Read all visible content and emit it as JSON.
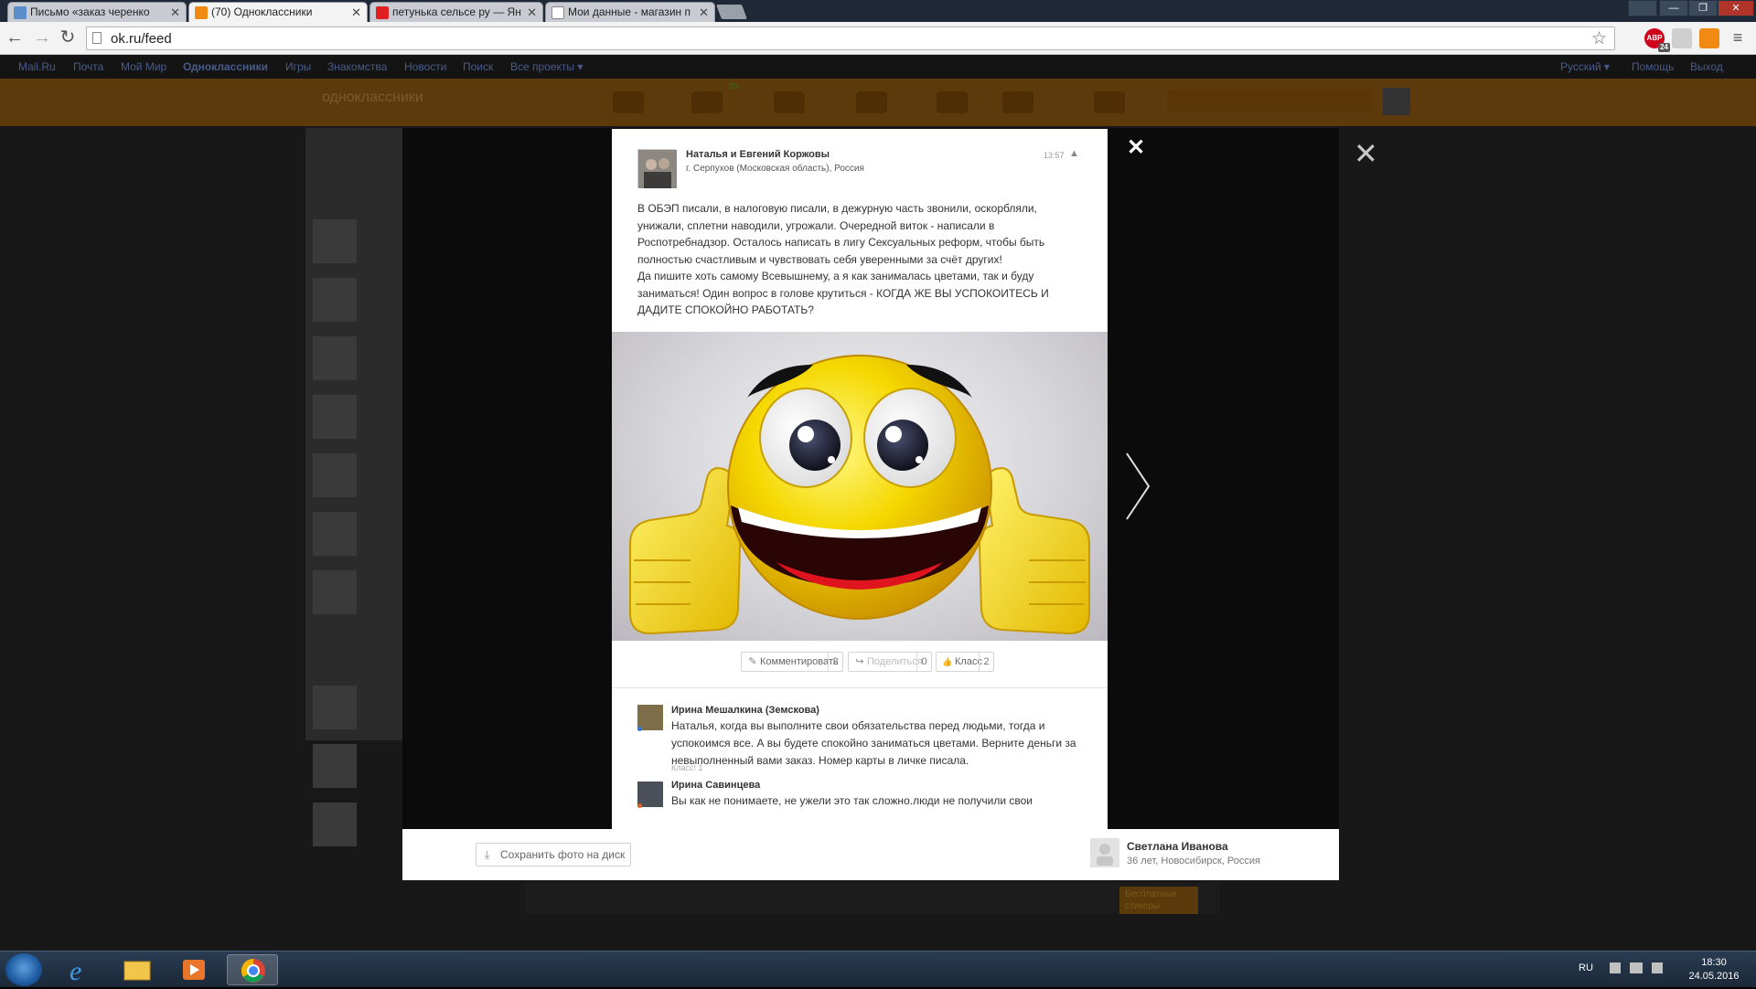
{
  "browser": {
    "tabs": [
      {
        "title": "Письмо «заказ черенко",
        "icon_color": "#5b8ec9",
        "active": false
      },
      {
        "title": "(70) Одноклассники",
        "icon_color": "#f08a12",
        "active": true
      },
      {
        "title": "петунька сельсе ру — Ян",
        "icon_color": "#e02020",
        "active": false
      },
      {
        "title": "Мои данные - магазин п",
        "icon_color": "#ffffff",
        "active": false
      }
    ],
    "tab_close": "✕",
    "url": "ok.ru/feed",
    "window_buttons": {
      "minimize": "—",
      "maximize": "❐",
      "close": "✕"
    },
    "nav": {
      "back": "←",
      "forward": "→",
      "reload": "↻"
    },
    "ext_abp": "ABP",
    "ext_abp_badge": "24",
    "star": "☆",
    "menu": "≡"
  },
  "page_bg": {
    "topline_links": [
      "Mail.Ru",
      "Почта",
      "Мой Мир",
      "Одноклассники",
      "Игры",
      "Знакомства",
      "Новости",
      "Поиск",
      "Все проекты ▾"
    ],
    "topline_right": [
      "Русский ▾",
      "Помощь",
      "Выход"
    ],
    "logo": "одноклассники",
    "header_badge": "70"
  },
  "viewer": {
    "close": "✕",
    "inner_close": "✕"
  },
  "post": {
    "author": "Наталья и Евгений Коржовы",
    "location": "г. Серпухов (Московская область), Россия",
    "time": "13:57",
    "warn": "▲",
    "text": "В ОБЭП писали, в налоговую писали, в дежурную часть звонили, оскорбляли,\nунижали, сплетни наводили, угрожали. Очередной виток - написали в\nРоспотребнадзор. Осталось написать в лигу Сексуальных реформ, чтобы быть\nполностью счастливым и чувствовать себя уверенными за счёт других!\nДа пишите хоть самому Всевышнему, а я как занималась цветами, так и буду\nзаниматься! Один вопрос в голове крутиться - КОГДА ЖЕ ВЫ УСПОКОИТЕСЬ  И\nДАДИТЕ СПОКОЙНО РАБОТАТЬ?",
    "photo_alt": "smiley thumbs up"
  },
  "actions": {
    "comment": {
      "label": "Комментировать",
      "count": "2",
      "icon": "✎"
    },
    "share": {
      "label": "Поделиться",
      "count": "0",
      "icon": "↪"
    },
    "like": {
      "label": "Класс",
      "count": "2",
      "icon": "👍"
    }
  },
  "comments": [
    {
      "name": "Ирина Мешалкина (Земскова)",
      "text": "Наталья, когда вы выполните свои обязательства перед людьми, тогда и успокоимся все. А вы будете спокойно заниматься цветами.  Верните деньги за невыполненный  вами заказ. Номер карты в личке писала.",
      "klass": "Класс! 1",
      "status_color": "#2f7bd6"
    },
    {
      "name": "Ирина Савинцева",
      "text": "Вы как не понимаете, не ужели это так сложно.люди не получили свои",
      "status_color": "#e06020"
    }
  ],
  "bottom": {
    "save": "Сохранить фото на диск",
    "save_icon": "⤓",
    "viewer_name": "Светлана Иванова",
    "viewer_info": "36 лет, Новосибирск, Россия"
  },
  "under": {
    "stickers": "Бесплатные стикеры"
  },
  "taskbar": {
    "lang": "RU",
    "time": "18:30",
    "date": "24.05.2016"
  }
}
